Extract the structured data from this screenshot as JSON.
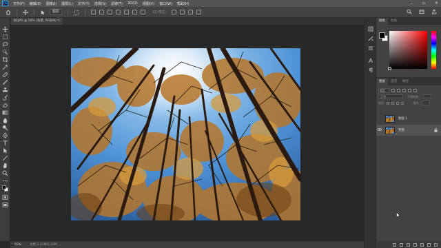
{
  "app": {
    "logo": "Ps"
  },
  "menu": [
    "文件(F)",
    "编辑(E)",
    "图像(I)",
    "图层(L)",
    "文字(Y)",
    "选择(S)",
    "滤镜(T)",
    "3D(D)",
    "视图(V)",
    "窗口(W)",
    "帮助(H)"
  ],
  "options_bar": {
    "auto_select_value": "图层",
    "mode_label": "3D 模式:"
  },
  "document": {
    "tab_label": "树.JPG @ 50% (背景, RGB/8) *",
    "tab_close": "×"
  },
  "status_bar": {
    "zoom": "50%",
    "doc_info": "文档:5.42M/5.42M",
    "arrow": "›"
  },
  "panels": {
    "color_tabs": [
      "颜色",
      "色板"
    ],
    "layers_tabs": [
      "图层",
      "通道",
      "路径"
    ],
    "kind_label": "类型",
    "blend_mode": "正常",
    "opacity_label": "不透明度:",
    "opacity_value": "",
    "lock_label": "锁定:",
    "fill_label": "填充:",
    "fill_value": "",
    "layers": [
      {
        "name": "图层 1",
        "visible": false,
        "selected": false
      },
      {
        "name": "背景",
        "visible": true,
        "selected": true,
        "locked": true
      }
    ]
  },
  "colors": {
    "foreground": "#000000",
    "background": "#ffffff",
    "picker_hue": "#ff0000",
    "ui_dark": "#282828",
    "ui_panel": "#424242"
  },
  "icons": [
    "move-icon",
    "marquee-icon",
    "lasso-icon",
    "quick-select-icon",
    "crop-icon",
    "eyedropper-icon",
    "healing-icon",
    "brush-icon",
    "clone-stamp-icon",
    "history-brush-icon",
    "eraser-icon",
    "gradient-icon",
    "blur-icon",
    "dodge-icon",
    "pen-icon",
    "type-icon",
    "path-select-icon",
    "rectangle-icon",
    "hand-icon",
    "zoom-icon",
    "edit-toolbar-icon",
    "swap-colors-icon",
    "quick-mask-icon",
    "screen-mode-icon"
  ]
}
